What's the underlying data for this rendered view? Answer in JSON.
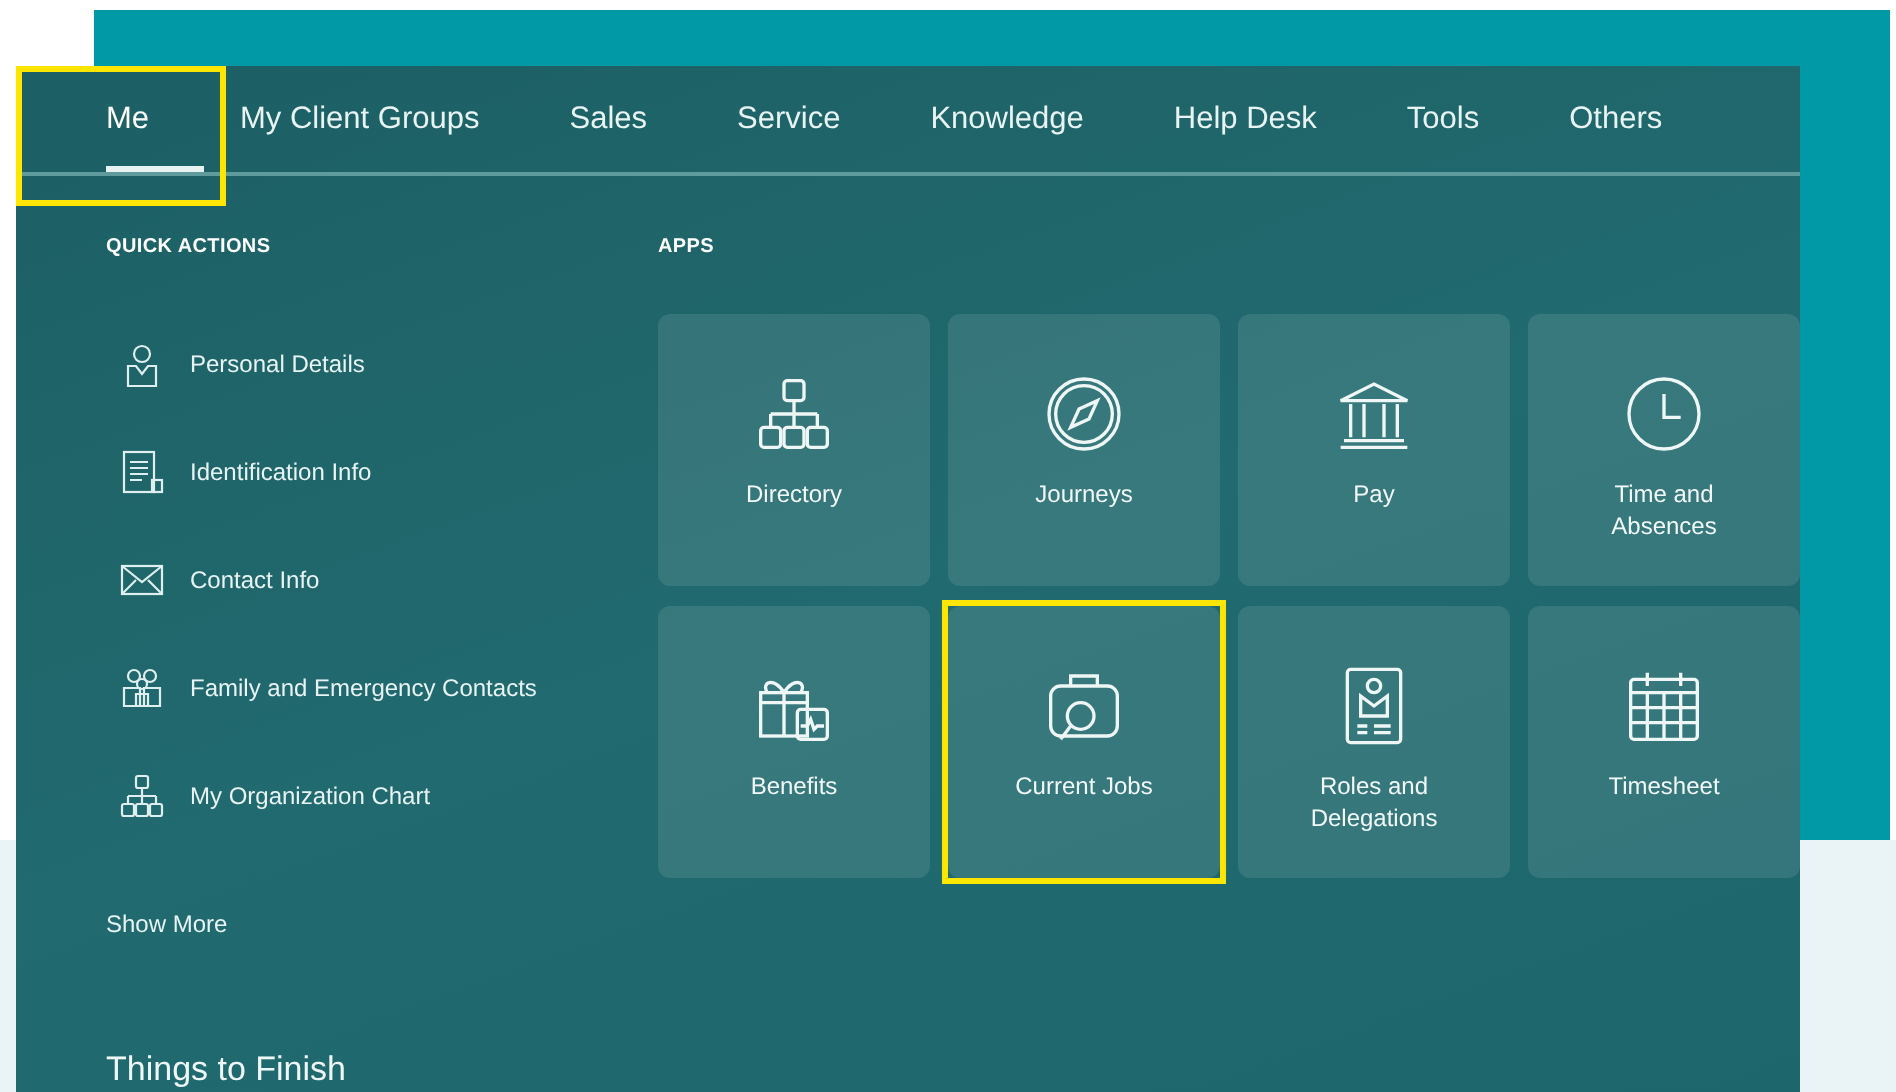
{
  "tabs": [
    {
      "label": "Me",
      "selected": true,
      "highlighted": true
    },
    {
      "label": "My Client Groups",
      "selected": false,
      "highlighted": false
    },
    {
      "label": "Sales",
      "selected": false,
      "highlighted": false
    },
    {
      "label": "Service",
      "selected": false,
      "highlighted": false
    },
    {
      "label": "Knowledge",
      "selected": false,
      "highlighted": false
    },
    {
      "label": "Help Desk",
      "selected": false,
      "highlighted": false
    },
    {
      "label": "Tools",
      "selected": false,
      "highlighted": false
    },
    {
      "label": "Others",
      "selected": false,
      "highlighted": false
    }
  ],
  "quick_actions": {
    "title": "QUICK ACTIONS",
    "items": [
      {
        "label": "Personal Details",
        "kind": "person"
      },
      {
        "label": "Identification Info",
        "kind": "document"
      },
      {
        "label": "Contact Info",
        "kind": "envelope"
      },
      {
        "label": "Family and Emergency Contacts",
        "kind": "family"
      },
      {
        "label": "My Organization Chart",
        "kind": "org"
      }
    ],
    "show_more": "Show More"
  },
  "apps": {
    "title": "APPS",
    "tiles": [
      {
        "label": "Directory",
        "kind": "org",
        "highlighted": false
      },
      {
        "label": "Journeys",
        "kind": "compass",
        "highlighted": false
      },
      {
        "label": "Pay",
        "kind": "bank",
        "highlighted": false
      },
      {
        "label": "Time and Absences",
        "kind": "clock",
        "highlighted": false
      },
      {
        "label": "Benefits",
        "kind": "gift",
        "highlighted": false
      },
      {
        "label": "Current Jobs",
        "kind": "briefcase",
        "highlighted": true
      },
      {
        "label": "Roles and Delegations",
        "kind": "badge",
        "highlighted": false
      },
      {
        "label": "Timesheet",
        "kind": "calendar",
        "highlighted": false
      }
    ]
  },
  "section_title": "Things to Finish"
}
